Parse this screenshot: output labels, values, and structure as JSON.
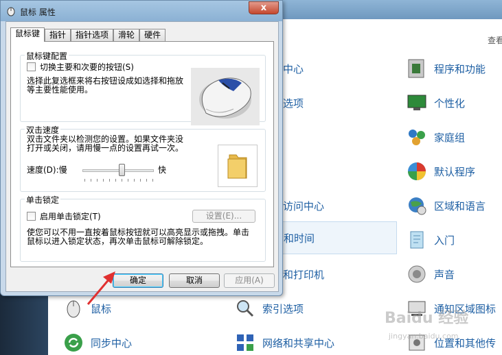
{
  "dialog": {
    "title": "鼠标 属性",
    "close_glyph": "x",
    "tabs": [
      {
        "label": "鼠标键"
      },
      {
        "label": "指针"
      },
      {
        "label": "指针选项"
      },
      {
        "label": "滑轮"
      },
      {
        "label": "硬件"
      }
    ],
    "button_config": {
      "title": "鼠标键配置",
      "checkbox_label": "切换主要和次要的按钮(S)",
      "description_line1": "选择此复选框来将右按钮设成如选择和拖放",
      "description_line2": "等主要性能使用。"
    },
    "double_click": {
      "title": "双击速度",
      "description_line1": "双击文件夹以检测您的设置。如果文件夹没",
      "description_line2": "打开或关闭，请用慢一点的设置再试一次。",
      "speed_label": "速度(D):慢",
      "fast_label": "快",
      "speed_value": 0.55
    },
    "click_lock": {
      "title": "单击锁定",
      "checkbox_label": "启用单击锁定(T)",
      "settings_button": "设置(E)...",
      "description_line1": "使您可以不用一直按着鼠标按钮就可以高亮显示或拖拽。单击",
      "description_line2": "鼠标以进入锁定状态，再次单击鼠标可解除锁定。"
    },
    "buttons": {
      "ok": "确定",
      "cancel": "取消",
      "apply": "应用(A)"
    }
  },
  "control_panel": {
    "view_link": "查看",
    "partial_items": [
      "中心",
      "选项",
      "访问中心",
      "和时间",
      "和打印机"
    ],
    "items_right": [
      {
        "label": "程序和功能",
        "icon": "programs-icon"
      },
      {
        "label": "个性化",
        "icon": "personalization-icon"
      },
      {
        "label": "家庭组",
        "icon": "homegroup-icon"
      },
      {
        "label": "默认程序",
        "icon": "default-programs-icon"
      },
      {
        "label": "区域和语言",
        "icon": "region-language-icon"
      },
      {
        "label": "入门",
        "icon": "getting-started-icon"
      },
      {
        "label": "声音",
        "icon": "sound-icon"
      },
      {
        "label": "通知区域图标",
        "icon": "notification-icons-icon"
      },
      {
        "label": "位置和其他传",
        "icon": "location-sensors-icon"
      }
    ],
    "items_bottom": [
      {
        "label": "鼠标",
        "icon": "mouse-icon"
      },
      {
        "label": "索引选项",
        "icon": "indexing-icon"
      },
      {
        "label": "同步中心",
        "icon": "sync-center-icon"
      },
      {
        "label": "网络和共享中心",
        "icon": "network-icon"
      }
    ]
  },
  "watermark": {
    "text": "Baidu 经验",
    "url": "jingyan.baidu.com"
  },
  "colors": {
    "link": "#1e5fa3",
    "ok_border": "#3c7fb1",
    "arrow": "#e03030"
  }
}
